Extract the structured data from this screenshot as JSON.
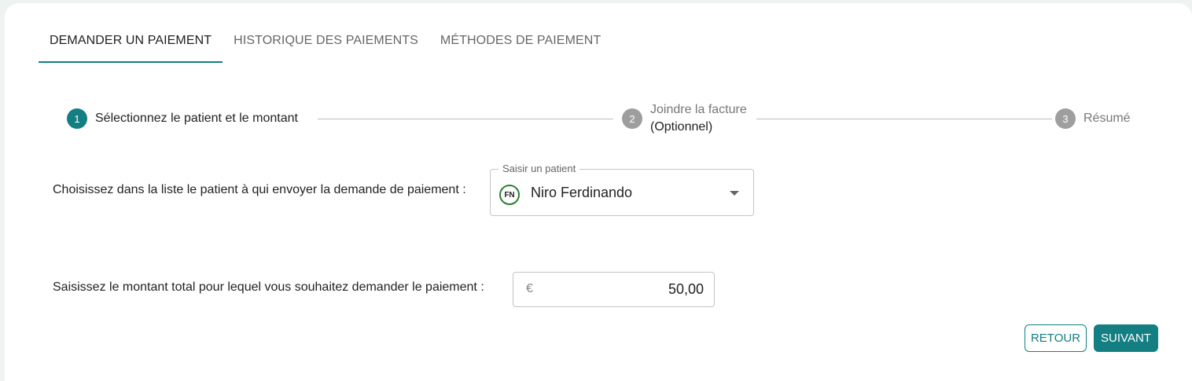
{
  "tabs": [
    {
      "label": "DEMANDER UN PAIEMENT",
      "active": true
    },
    {
      "label": "HISTORIQUE DES PAIEMENTS",
      "active": false
    },
    {
      "label": "MÉTHODES DE PAIEMENT",
      "active": false
    }
  ],
  "stepper": {
    "steps": [
      {
        "number": "1",
        "label": "Sélectionnez le patient et le montant",
        "sublabel": "",
        "state": "active"
      },
      {
        "number": "2",
        "label": "Joindre la facture",
        "sublabel": "(Optionnel)",
        "state": "inactive"
      },
      {
        "number": "3",
        "label": "Résumé",
        "sublabel": "",
        "state": "inactive"
      }
    ]
  },
  "patient": {
    "prompt": "Choisissez dans la liste le patient à qui envoyer la demande de paiement :",
    "field_label": "Saisir un patient",
    "avatar_initials": "FN",
    "selected_name": "Niro Ferdinando"
  },
  "amount": {
    "prompt": "Saisissez le montant total pour lequel vous souhaitez demander le paiement :",
    "currency_symbol": "€",
    "value": "50,00"
  },
  "actions": {
    "back_label": "RETOUR",
    "next_label": "SUIVANT"
  },
  "colors": {
    "accent": "#137f83",
    "inactive_step": "#9e9e9e",
    "avatar_ring": "#2e7d32"
  }
}
